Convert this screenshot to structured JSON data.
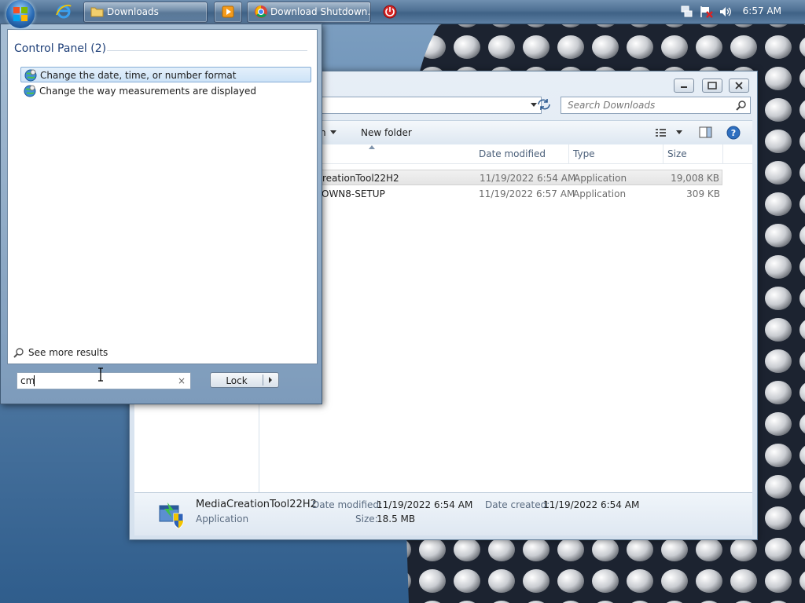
{
  "taskbar": {
    "buttons": [
      {
        "label": "Downloads",
        "icon": "folder-icon"
      },
      {
        "label": "Download Shutdown...",
        "icon": "chrome-icon"
      }
    ],
    "pinned_icons": [
      "internet-explorer-icon",
      "media-player-icon",
      "power-app-icon"
    ],
    "tray_icons": [
      "network-icon",
      "action-center-flag-icon",
      "volume-icon"
    ],
    "clock": "6:57 AM"
  },
  "explorer": {
    "search_placeholder": "Search Downloads",
    "commands": {
      "new_folder": "New folder",
      "partial_command": "n"
    },
    "columns": [
      "Date modified",
      "Type",
      "Size"
    ],
    "files": [
      {
        "name": "reationTool22H2",
        "date": "11/19/2022 6:54 AM",
        "type": "Application",
        "size": "19,008 KB",
        "selected": true
      },
      {
        "name": "OWN8-SETUP",
        "date": "11/19/2022 6:57 AM",
        "type": "Application",
        "size": "309 KB",
        "selected": false
      }
    ],
    "details": {
      "name": "MediaCreationTool22H2",
      "type": "Application",
      "date_modified_label": "Date modified:",
      "date_modified": "11/19/2022 6:54 AM",
      "size_label": "Size:",
      "size": "18.5 MB",
      "date_created_label": "Date created:",
      "date_created": "11/19/2022 6:54 AM"
    }
  },
  "startmenu": {
    "group_title": "Control Panel (2)",
    "results": [
      {
        "label": "Change the date, time, or number format",
        "highlighted": true
      },
      {
        "label": "Change the way measurements are displayed",
        "highlighted": false
      }
    ],
    "see_more": "See more results",
    "search_value": "cm",
    "clear_glyph": "×",
    "lock_label": "Lock"
  },
  "colors": {
    "accent": "#1e3f78",
    "taskbar": "#4e7093",
    "highlight_border": "#84acd6"
  }
}
